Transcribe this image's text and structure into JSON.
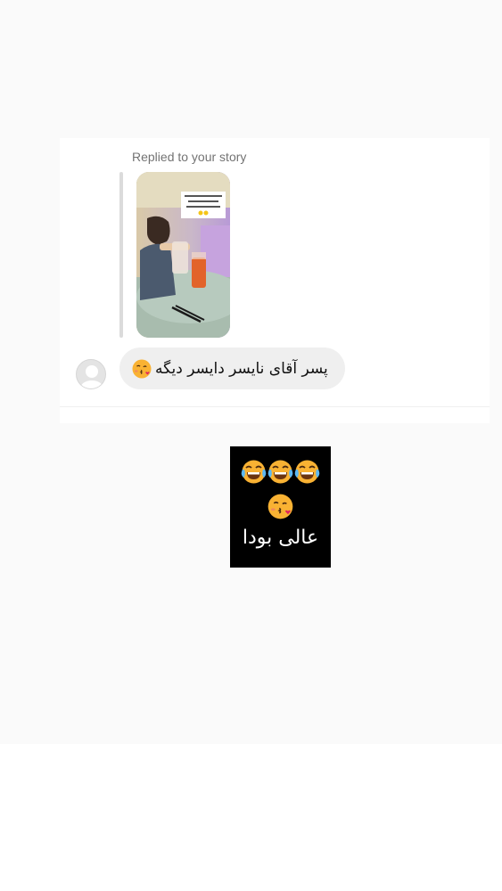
{
  "reply": {
    "label": "Replied to your story",
    "story_caption": "این تو این تره خیلی ها داشت انجام میده و دو لایه رو باز کرده"
  },
  "message": {
    "text": "پسر آقای نایسر دایسر دیگه",
    "emoji": "face-blowing-kiss"
  },
  "sticker": {
    "emojis_row1": [
      "face-with-tears-of-joy",
      "face-with-tears-of-joy",
      "face-with-tears-of-joy"
    ],
    "emojis_row2": [
      "face-blowing-kiss"
    ],
    "text": "عالی بودا"
  },
  "colors": {
    "background": "#fafafa",
    "bubble": "#efefef",
    "secondary_text": "#737373",
    "sticker_bg": "#000000"
  }
}
